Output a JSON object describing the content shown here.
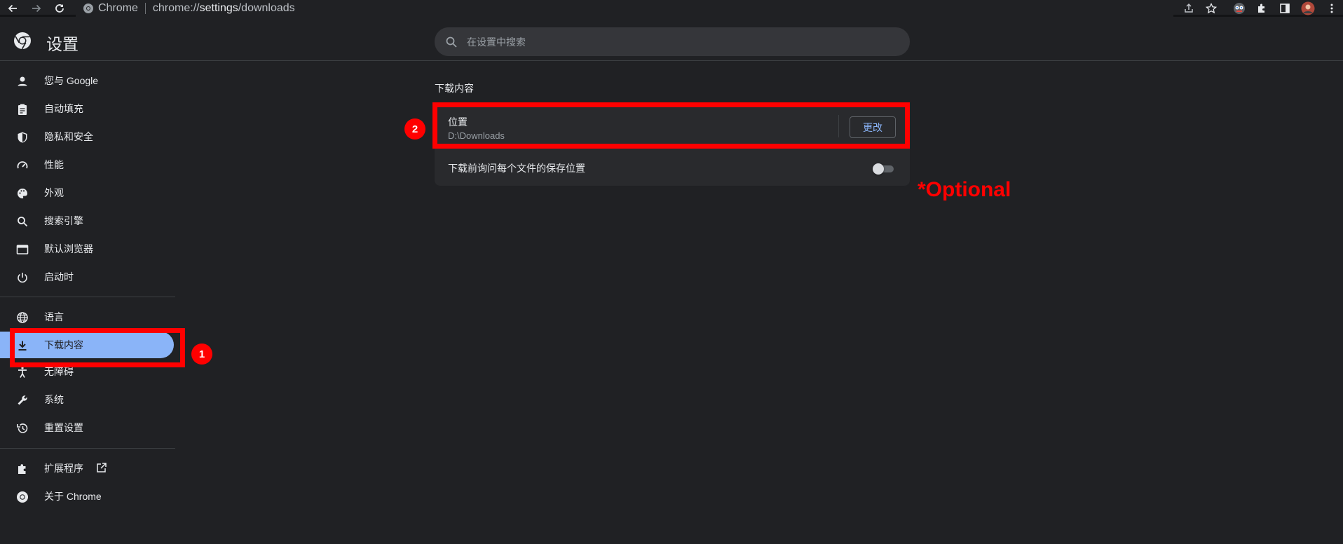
{
  "browser": {
    "site_label": "Chrome",
    "url_scheme": "chrome://",
    "url_host": "settings",
    "url_path": "/downloads"
  },
  "header": {
    "title": "设置",
    "search_placeholder": "在设置中搜索"
  },
  "sidebar": {
    "items": [
      {
        "label": "您与 Google",
        "icon": "person-icon"
      },
      {
        "label": "自动填充",
        "icon": "clipboard-icon"
      },
      {
        "label": "隐私和安全",
        "icon": "shield-icon"
      },
      {
        "label": "性能",
        "icon": "speedometer-icon"
      },
      {
        "label": "外观",
        "icon": "palette-icon"
      },
      {
        "label": "搜索引擎",
        "icon": "search-icon"
      },
      {
        "label": "默认浏览器",
        "icon": "browser-icon"
      },
      {
        "label": "启动时",
        "icon": "power-icon"
      },
      {
        "label": "语言",
        "icon": "globe-icon"
      },
      {
        "label": "下载内容",
        "icon": "download-icon",
        "active": true
      },
      {
        "label": "无障碍",
        "icon": "accessibility-icon"
      },
      {
        "label": "系统",
        "icon": "wrench-icon"
      },
      {
        "label": "重置设置",
        "icon": "history-icon"
      },
      {
        "label": "扩展程序",
        "icon": "puzzle-icon"
      },
      {
        "label": "关于 Chrome",
        "icon": "chrome-icon"
      }
    ]
  },
  "main": {
    "section_title": "下载内容",
    "location_label": "位置",
    "location_path": "D:\\Downloads",
    "change_button": "更改",
    "ask_label": "下载前询问每个文件的保存位置",
    "ask_enabled": false
  },
  "annotations": {
    "badge1": "1",
    "badge2": "2",
    "optional_note": "*Optional",
    "color": "#ff0000"
  },
  "colors": {
    "accent": "#8ab4f8",
    "background": "#202124",
    "card": "#292a2d"
  }
}
